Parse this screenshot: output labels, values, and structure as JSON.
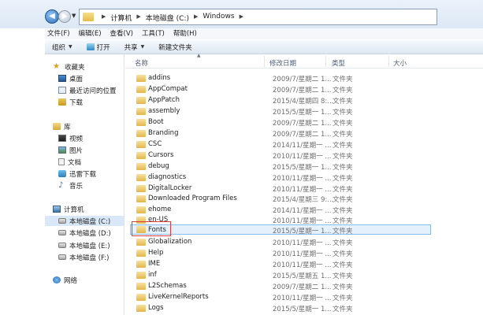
{
  "address": {
    "crumbs": [
      "计算机",
      "本地磁盘 (C:)",
      "Windows"
    ]
  },
  "menu": [
    "文件(F)",
    "编辑(E)",
    "查看(V)",
    "工具(T)",
    "帮助(H)"
  ],
  "toolbar": {
    "organize": "组织",
    "open": "打开",
    "share": "共享",
    "new_folder": "新建文件夹"
  },
  "nav": {
    "favorites": "收藏夹",
    "desktop": "桌面",
    "recent": "最近访问的位置",
    "downloads": "下载",
    "libraries": "库",
    "videos": "视频",
    "pictures": "图片",
    "documents": "文档",
    "thunder": "迅雷下载",
    "music": "音乐",
    "computer": "计算机",
    "drive_c": "本地磁盘 (C:)",
    "drive_d": "本地磁盘 (D:)",
    "drive_e": "本地磁盘 (E:)",
    "drive_f": "本地磁盘 (F:)",
    "network": "网络"
  },
  "columns": {
    "name": "名称",
    "modified": "修改日期",
    "type": "类型",
    "size": "大小"
  },
  "files": [
    {
      "name": "addins",
      "date": "2009/7/星期二 1...",
      "type": "文件夹"
    },
    {
      "name": "AppCompat",
      "date": "2009/7/星期二 1...",
      "type": "文件夹"
    },
    {
      "name": "AppPatch",
      "date": "2015/4/星期四 8:...",
      "type": "文件夹"
    },
    {
      "name": "assembly",
      "date": "2015/5/星期一 1...",
      "type": "文件夹"
    },
    {
      "name": "Boot",
      "date": "2009/7/星期二 1...",
      "type": "文件夹"
    },
    {
      "name": "Branding",
      "date": "2009/7/星期二 1...",
      "type": "文件夹"
    },
    {
      "name": "CSC",
      "date": "2014/11/星期一 ...",
      "type": "文件夹"
    },
    {
      "name": "Cursors",
      "date": "2010/11/星期一 ...",
      "type": "文件夹"
    },
    {
      "name": "debug",
      "date": "2015/5/星期一 1...",
      "type": "文件夹"
    },
    {
      "name": "diagnostics",
      "date": "2010/11/星期一 ...",
      "type": "文件夹"
    },
    {
      "name": "DigitalLocker",
      "date": "2010/11/星期一 ...",
      "type": "文件夹"
    },
    {
      "name": "Downloaded Program Files",
      "date": "2015/4/星期三 9:...",
      "type": "文件夹"
    },
    {
      "name": "ehome",
      "date": "2014/11/星期一 ...",
      "type": "文件夹"
    },
    {
      "name": "en-US",
      "date": "2010/11/星期一 ...",
      "type": "文件夹"
    },
    {
      "name": "Fonts",
      "date": "2015/5/星期一 1...",
      "type": "文件夹"
    },
    {
      "name": "Globalization",
      "date": "2010/11/星期一 ...",
      "type": "文件夹"
    },
    {
      "name": "Help",
      "date": "2010/11/星期一 ...",
      "type": "文件夹"
    },
    {
      "name": "IME",
      "date": "2010/11/星期一 ...",
      "type": "文件夹"
    },
    {
      "name": "inf",
      "date": "2015/5/星期五 1...",
      "type": "文件夹"
    },
    {
      "name": "L2Schemas",
      "date": "2009/7/星期二 1...",
      "type": "文件夹"
    },
    {
      "name": "LiveKernelReports",
      "date": "2010/11/星期一 ...",
      "type": "文件夹"
    },
    {
      "name": "Logs",
      "date": "2015/5/星期一 1...",
      "type": "文件夹"
    }
  ]
}
